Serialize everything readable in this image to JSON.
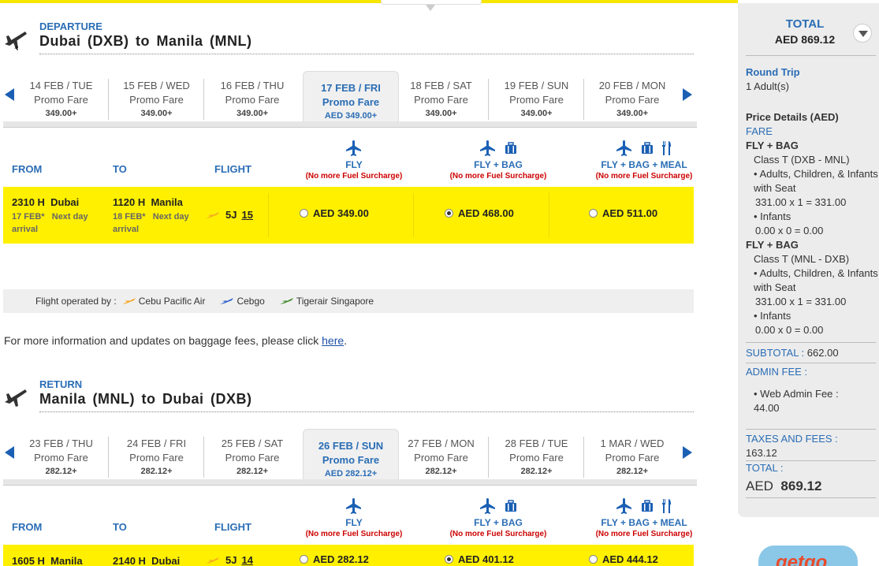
{
  "departure": {
    "label": "DEPARTURE",
    "route": "Dubai (DXB) to Manila (MNL)",
    "dates": [
      {
        "date": "14 FEB / TUE",
        "fare": "Promo Fare",
        "price": "349.00+"
      },
      {
        "date": "15 FEB / WED",
        "fare": "Promo Fare",
        "price": "349.00+"
      },
      {
        "date": "16 FEB / THU",
        "fare": "Promo Fare",
        "price": "349.00+"
      },
      {
        "date": "17 FEB / FRI",
        "fare": "Promo Fare",
        "price": "AED 349.00+"
      },
      {
        "date": "18 FEB / SAT",
        "fare": "Promo Fare",
        "price": "349.00+"
      },
      {
        "date": "19 FEB / SUN",
        "fare": "Promo Fare",
        "price": "349.00+"
      },
      {
        "date": "20 FEB / MON",
        "fare": "Promo Fare",
        "price": "349.00+"
      }
    ],
    "flight": {
      "dep_time": "2310 H",
      "dep_city": "Dubai",
      "dep_date": "17 FEB*",
      "dep_note": "Next day",
      "dep_note2": "arrival",
      "arr_time": "1120 H",
      "arr_city": "Manila",
      "arr_date": "18 FEB*",
      "arr_note": "Next day",
      "arr_note2": "arrival",
      "code": "5J",
      "number": "15",
      "fly_price": "AED 349.00",
      "flybag_price": "AED 468.00",
      "flybagmeal_price": "AED 511.00",
      "selected": "flybag"
    }
  },
  "return": {
    "label": "RETURN",
    "route": "Manila (MNL) to Dubai (DXB)",
    "dates": [
      {
        "date": "23 FEB / THU",
        "fare": "Promo Fare",
        "price": "282.12+"
      },
      {
        "date": "24 FEB / FRI",
        "fare": "Promo Fare",
        "price": "282.12+"
      },
      {
        "date": "25 FEB / SAT",
        "fare": "Promo Fare",
        "price": "282.12+"
      },
      {
        "date": "26 FEB / SUN",
        "fare": "Promo Fare",
        "price": "AED 282.12+"
      },
      {
        "date": "27 FEB / MON",
        "fare": "Promo Fare",
        "price": "282.12+"
      },
      {
        "date": "28 FEB / TUE",
        "fare": "Promo Fare",
        "price": "282.12+"
      },
      {
        "date": "1 MAR / WED",
        "fare": "Promo Fare",
        "price": "282.12+"
      }
    ],
    "flight": {
      "dep_time": "1605 H",
      "dep_city": "Manila",
      "arr_time": "2140 H",
      "arr_city": "Dubai",
      "code": "5J",
      "number": "14",
      "fly_price": "AED 282.12",
      "flybag_price": "AED 401.12",
      "flybagmeal_price": "AED 444.12",
      "selected": "flybag"
    }
  },
  "headers": {
    "from": "FROM",
    "to": "TO",
    "flight": "FLIGHT",
    "fly": "FLY",
    "flybag": "FLY + BAG",
    "flybagmeal": "FLY + BAG + MEAL",
    "note": "(No more Fuel Surcharge)"
  },
  "operated": {
    "label": "Flight operated by :",
    "carriers": [
      "Cebu Pacific Air",
      "Cebgo",
      "Tigerair Singapore"
    ]
  },
  "info": {
    "text": "For more information and updates on baggage fees, please click ",
    "link": "here",
    "end": "."
  },
  "summary": {
    "total_label": "TOTAL",
    "total_value": "AED  869.12",
    "trip": "Round Trip",
    "pax": "1  Adult(s)",
    "price_details": "Price Details (AED)",
    "fare_label": "FARE",
    "seg1_name": "FLY + BAG",
    "seg1_class": "Class T (DXB - MNL)",
    "seg1_adults": "• Adults, Children, & Infants with Seat",
    "seg1_adults_calc": "331.00 x 1 = 331.00",
    "seg1_infants": "• Infants",
    "seg1_infants_calc": "0.00 x 0 = 0.00",
    "seg2_name": "FLY + BAG",
    "seg2_class": "Class T (MNL - DXB)",
    "seg2_adults": "• Adults, Children, & Infants with Seat",
    "seg2_adults_calc": "331.00 x 1 = 331.00",
    "seg2_infants": "• Infants",
    "seg2_infants_calc": "0.00 x 0 = 0.00",
    "subtotal_label": "SUBTOTAL :",
    "subtotal_value": "662.00",
    "admin_label": "ADMIN FEE :",
    "admin_item": "• Web Admin Fee :",
    "admin_value": "44.00",
    "taxes_label": "TAXES AND FEES :",
    "taxes_value": "163.12",
    "grand_label": "TOTAL :",
    "grand_currency": "AED",
    "grand_value": "869.12"
  },
  "colors": {
    "accent": "#2a6db5",
    "highlight": "#fff000",
    "alert": "#cc0000"
  }
}
